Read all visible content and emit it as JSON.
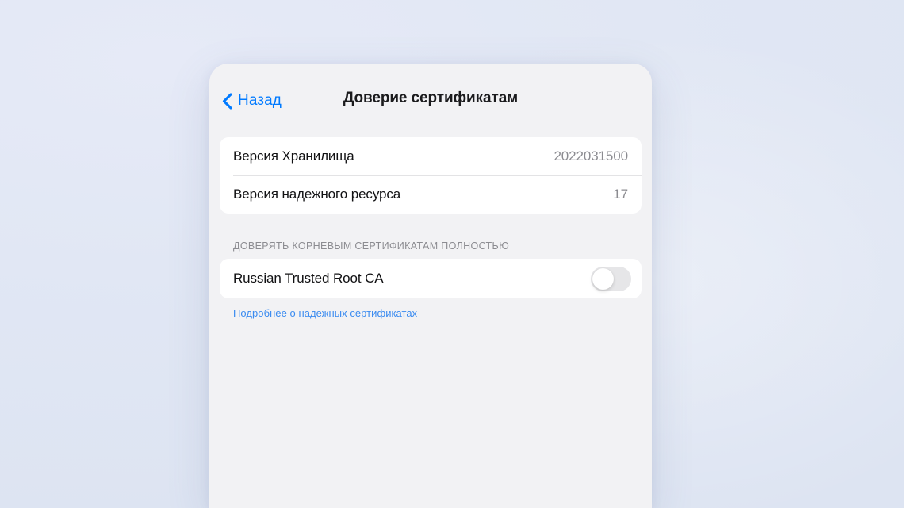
{
  "navbar": {
    "back_label": "Назад",
    "back_icon": "chevron-left-icon",
    "title": "Доверие сертификатам"
  },
  "info_section": {
    "rows": [
      {
        "label": "Версия Хранилища",
        "value": "2022031500"
      },
      {
        "label": "Версия надежного ресурса",
        "value": "17"
      }
    ]
  },
  "trust_section": {
    "header": "ДОВЕРЯТЬ КОРНЕВЫМ СЕРТИФИКАТАМ ПОЛНОСТЬЮ",
    "items": [
      {
        "label": "Russian Trusted Root CA",
        "toggle_state": "off"
      }
    ],
    "footnote_link": "Подробнее о надежных сертификатах"
  },
  "colors": {
    "accent": "#007aff",
    "link": "#3a8bf0",
    "secondary_text": "#8c8c91",
    "primary_text": "#111113",
    "panel_bg": "#f2f2f4",
    "card_bg": "#ffffff",
    "switch_off_track": "#e6e6e8",
    "page_bg": "#e3e8f5"
  }
}
